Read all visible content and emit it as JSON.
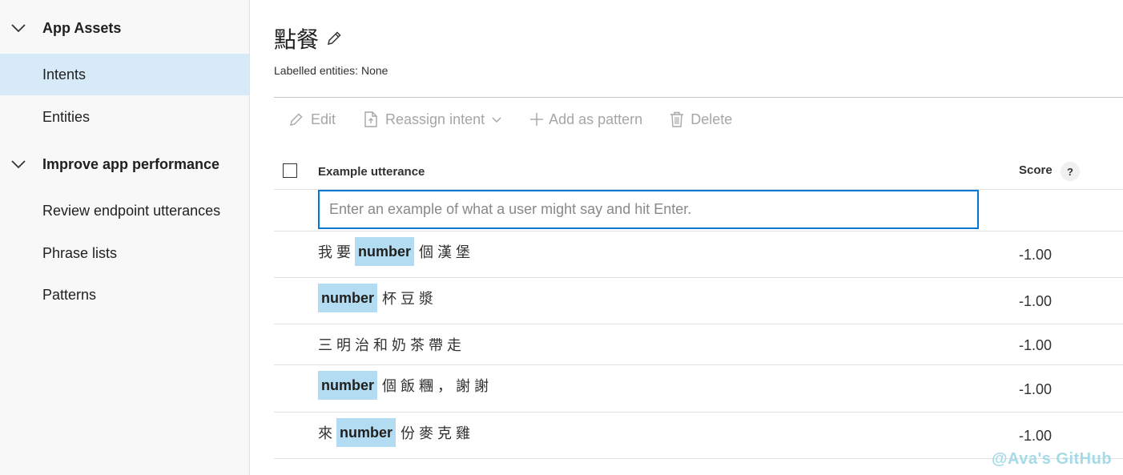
{
  "sidebar": {
    "sections": [
      {
        "label": "App Assets",
        "icon": "chevron-down-icon"
      },
      {
        "label": "Improve app performance",
        "icon": "chevron-down-icon"
      }
    ],
    "items": [
      {
        "label": "Intents",
        "selected": true
      },
      {
        "label": "Entities"
      },
      {
        "label": "Review endpoint utterances"
      },
      {
        "label": "Phrase lists"
      },
      {
        "label": "Patterns"
      }
    ]
  },
  "intent": {
    "title": "點餐",
    "labelled_entities": "Labelled entities: None"
  },
  "toolbar": {
    "edit": "Edit",
    "reassign": "Reassign intent",
    "add_pattern": "Add as pattern",
    "delete": "Delete"
  },
  "table": {
    "header_utterance": "Example utterance",
    "header_score": "Score",
    "help": "?",
    "input_placeholder": "Enter an example of what a user might say and hit Enter.",
    "rows": [
      {
        "before": "我要",
        "entity": "number",
        "after": "個漢堡",
        "score": "-1.00"
      },
      {
        "before": "",
        "entity": "number",
        "after": "杯豆漿",
        "score": "-1.00"
      },
      {
        "before": "三明治和奶茶帶走",
        "entity": "",
        "after": "",
        "score": "-1.00"
      },
      {
        "before": "",
        "entity": "number",
        "after": "個飯糰，謝謝",
        "score": "-1.00"
      },
      {
        "before": "來",
        "entity": "number",
        "after": "份麥克雞",
        "score": "-1.00"
      }
    ]
  },
  "watermark": "@Ava's GitHub",
  "colors": {
    "accent": "#0078d4",
    "selected_bg": "#d6eaf8",
    "entity_bg": "#b3dcf2"
  }
}
